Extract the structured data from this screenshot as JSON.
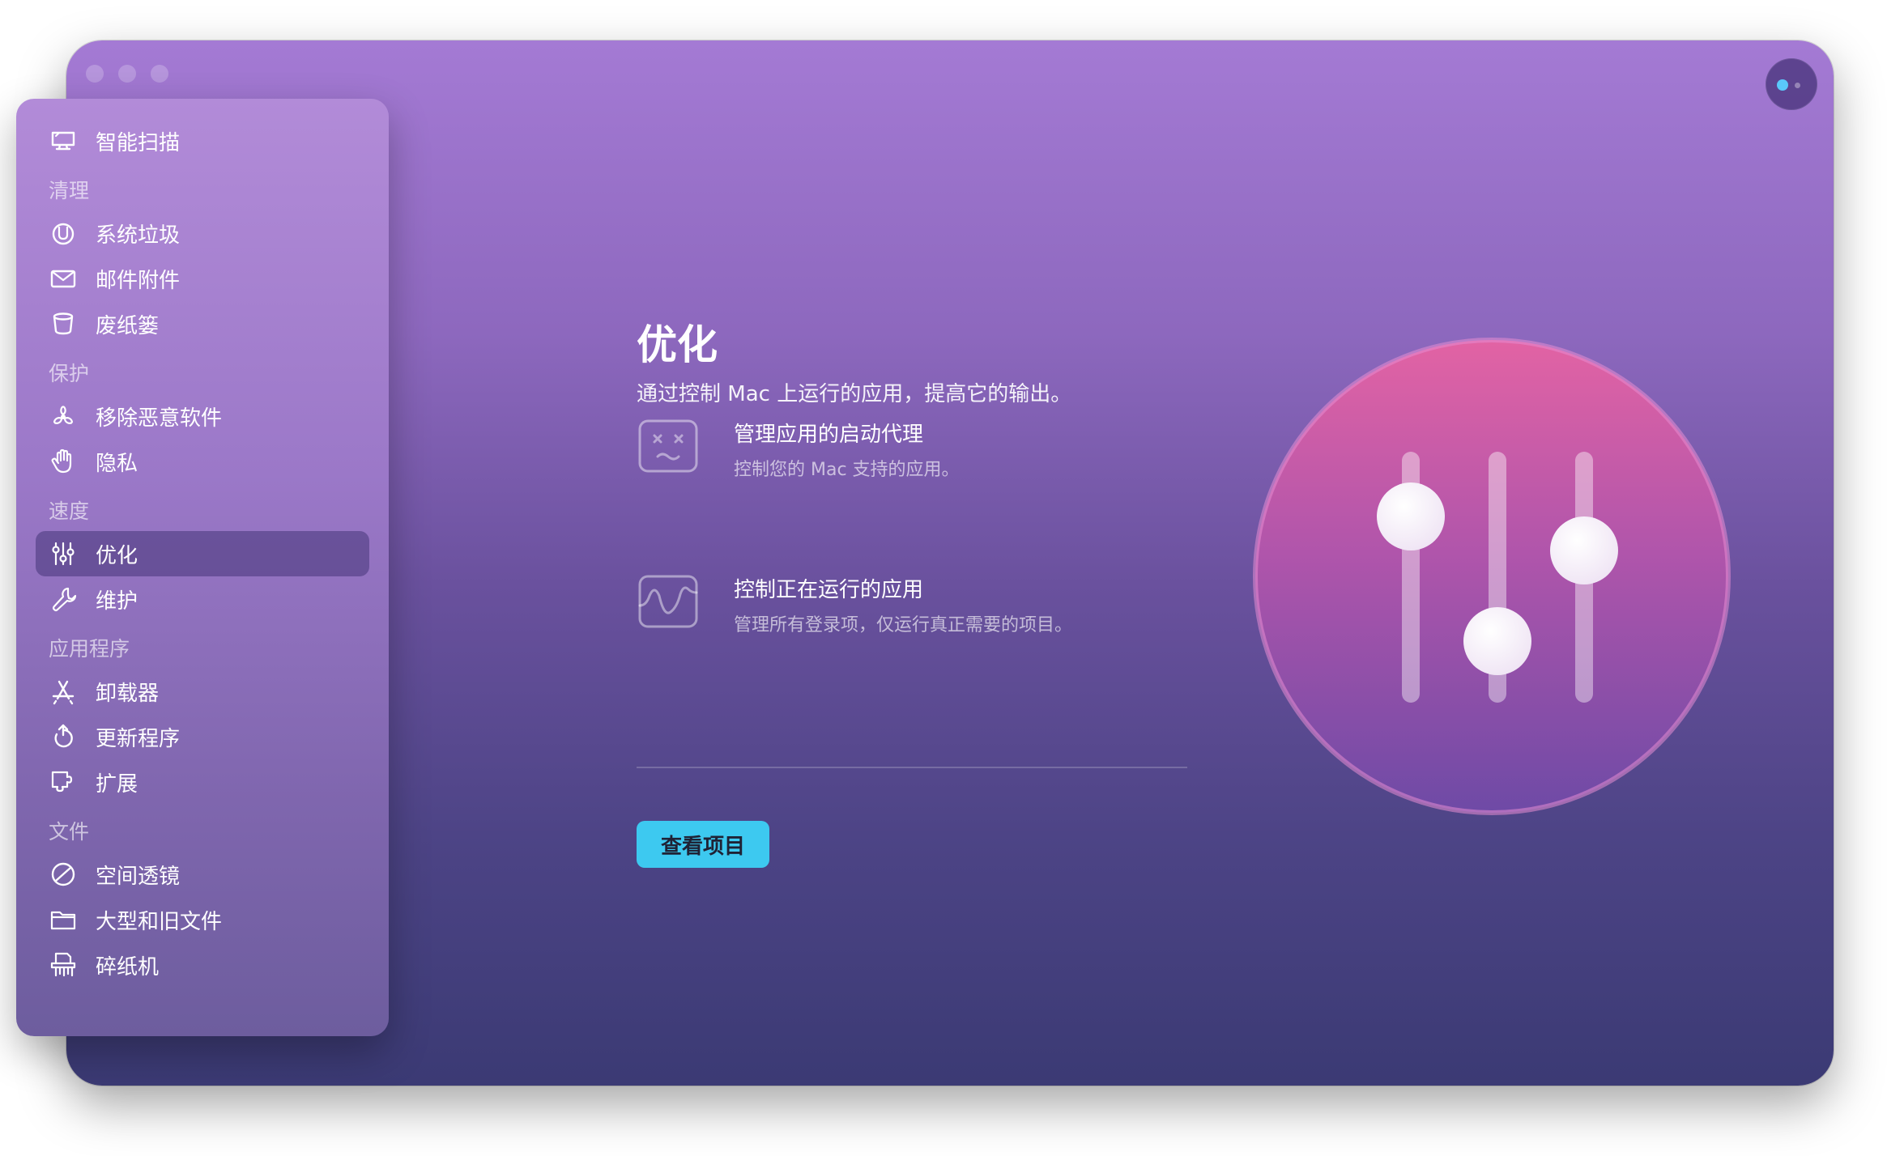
{
  "window": {
    "accent": "#3dc9f0"
  },
  "sidebar": {
    "smart_scan": {
      "label": "智能扫描",
      "icon": "monitor-icon"
    },
    "sections": [
      {
        "title": "清理",
        "items": [
          {
            "label": "系统垃圾",
            "icon": "trash-disk-icon"
          },
          {
            "label": "邮件附件",
            "icon": "envelope-icon"
          },
          {
            "label": "废纸篓",
            "icon": "bin-icon"
          }
        ]
      },
      {
        "title": "保护",
        "items": [
          {
            "label": "移除恶意软件",
            "icon": "biohazard-icon"
          },
          {
            "label": "隐私",
            "icon": "hand-icon"
          }
        ]
      },
      {
        "title": "速度",
        "items": [
          {
            "label": "优化",
            "icon": "sliders-icon",
            "active": true
          },
          {
            "label": "维护",
            "icon": "wrench-icon"
          }
        ]
      },
      {
        "title": "应用程序",
        "items": [
          {
            "label": "卸载器",
            "icon": "app-store-icon"
          },
          {
            "label": "更新程序",
            "icon": "update-arrow-icon"
          },
          {
            "label": "扩展",
            "icon": "extension-icon"
          }
        ]
      },
      {
        "title": "文件",
        "items": [
          {
            "label": "空间透镜",
            "icon": "lens-icon"
          },
          {
            "label": "大型和旧文件",
            "icon": "folder-icon"
          },
          {
            "label": "碎纸机",
            "icon": "shredder-icon"
          }
        ]
      }
    ]
  },
  "main": {
    "title": "优化",
    "subtitle": "通过控制 Mac 上运行的应用，提高它的输出。",
    "features": [
      {
        "title": "管理应用的启动代理",
        "description": "控制您的 Mac 支持的应用。",
        "icon": "dizzy-face-icon"
      },
      {
        "title": "控制正在运行的应用",
        "description": "管理所有登录项，仅运行真正需要的项目。",
        "icon": "activity-wave-icon"
      }
    ],
    "button_label": "查看项目"
  }
}
